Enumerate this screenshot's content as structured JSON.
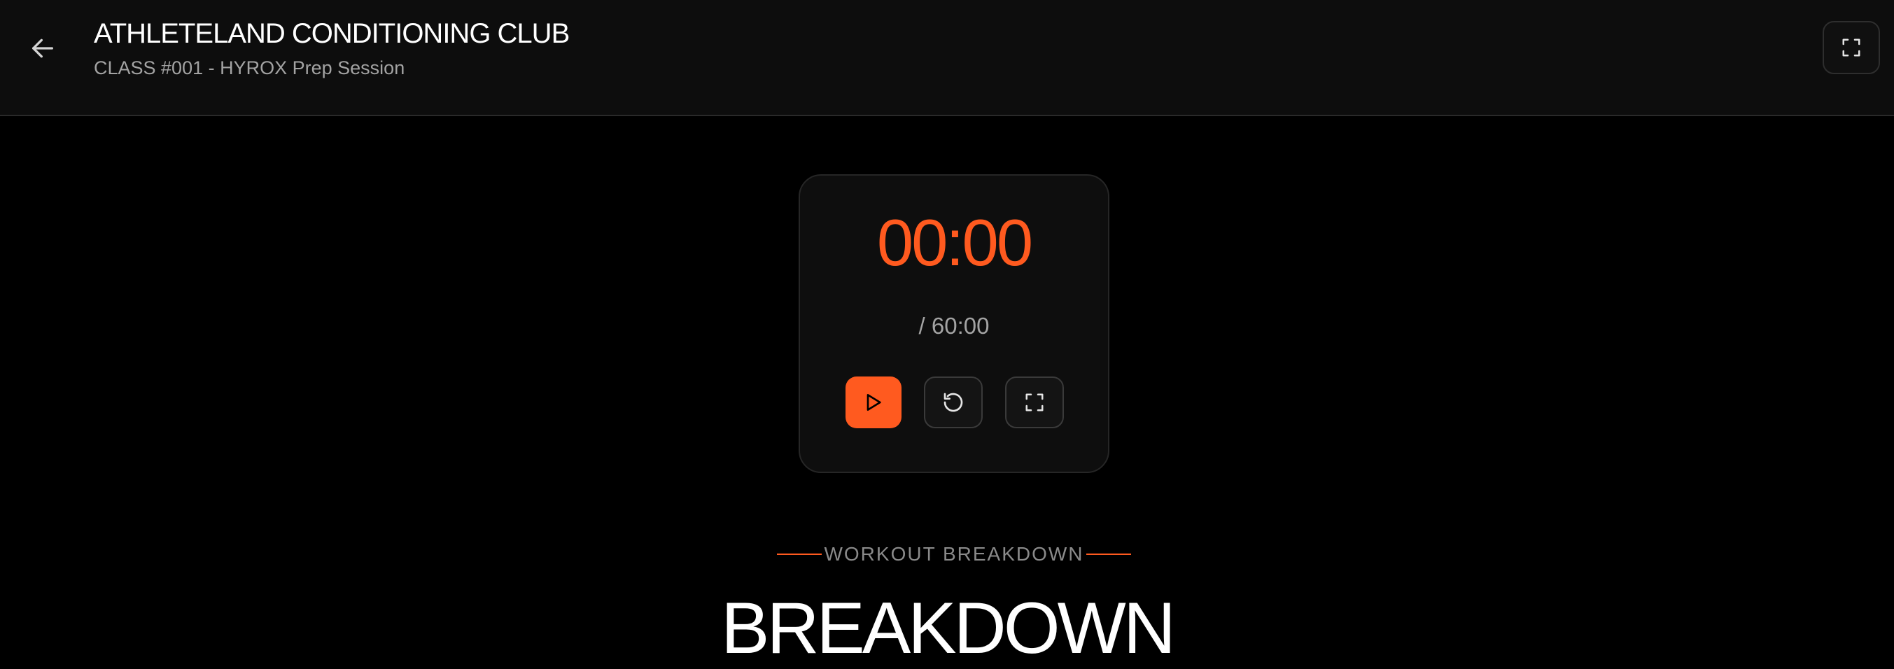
{
  "header": {
    "back_icon": "arrow-left-icon",
    "title": "ATHLETELAND CONDITIONING CLUB",
    "subtitle": "CLASS #001 - HYROX Prep Session",
    "fullscreen_icon": "fullscreen-icon"
  },
  "timer": {
    "elapsed": "00:00",
    "total": "/ 60:00",
    "controls": {
      "play_icon": "play-icon",
      "reset_icon": "reset-icon",
      "fullscreen_icon": "fullscreen-icon"
    }
  },
  "workout": {
    "eyebrow": "WORKOUT BREAKDOWN",
    "heading": "BREAKDOWN"
  },
  "colors": {
    "accent": "#ff5a1f",
    "background": "#000000",
    "header_background": "#0d0d0d",
    "card_background": "#0e0e0e",
    "muted_text": "#a3a3a3"
  }
}
